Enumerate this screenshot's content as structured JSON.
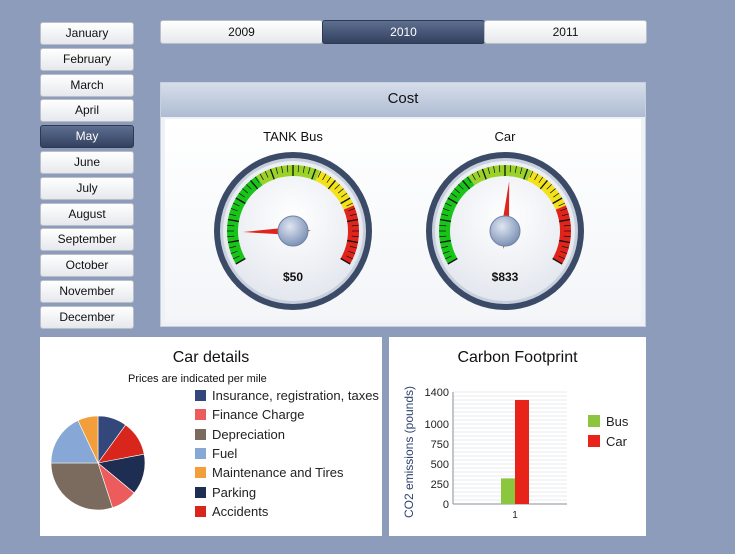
{
  "months": [
    "January",
    "February",
    "March",
    "April",
    "May",
    "June",
    "July",
    "August",
    "September",
    "October",
    "November",
    "December"
  ],
  "selected_month": "May",
  "years": [
    "2009",
    "2010",
    "2011"
  ],
  "selected_year": "2010",
  "cost": {
    "title": "Cost",
    "gauges": [
      {
        "name": "TANK Bus",
        "value_label": "$50",
        "needle_fraction": 0.12
      },
      {
        "name": "Car",
        "value_label": "$833",
        "needle_fraction": 0.52
      }
    ]
  },
  "car_details": {
    "title": "Car details",
    "subtitle": "Prices are indicated per mile",
    "legend": [
      {
        "label": "Insurance, registration, taxes",
        "color": "#34477a"
      },
      {
        "label": "Finance Charge",
        "color": "#ec5c5c"
      },
      {
        "label": "Depreciation",
        "color": "#7a6b5e"
      },
      {
        "label": "Fuel",
        "color": "#87a8d6"
      },
      {
        "label": "Maintenance and Tires",
        "color": "#f29e3b"
      },
      {
        "label": "Parking",
        "color": "#1e2d52"
      },
      {
        "label": "Accidents",
        "color": "#d8261c"
      }
    ],
    "chart_data": {
      "type": "pie",
      "slices": [
        {
          "label": "Insurance, registration, taxes",
          "value": 10,
          "color": "#34477a"
        },
        {
          "label": "Accidents",
          "value": 12,
          "color": "#d8261c"
        },
        {
          "label": "Parking",
          "value": 14,
          "color": "#1e2d52"
        },
        {
          "label": "Finance Charge",
          "value": 9,
          "color": "#ec5c5c"
        },
        {
          "label": "Depreciation",
          "value": 30,
          "color": "#7a6b5e"
        },
        {
          "label": "Fuel",
          "value": 18,
          "color": "#87a8d6"
        },
        {
          "label": "Maintenance and Tires",
          "value": 7,
          "color": "#f29e3b"
        }
      ]
    }
  },
  "carbon": {
    "title": "Carbon Footprint",
    "chart_data": {
      "type": "bar",
      "categories": [
        "1"
      ],
      "series": [
        {
          "name": "Bus",
          "values": [
            320
          ],
          "color": "#8cc63f"
        },
        {
          "name": "Car",
          "values": [
            1300
          ],
          "color": "#e8231a"
        }
      ],
      "ylabel": "CO2 emissions (pounds)",
      "yticks": [
        "0",
        "250",
        "500",
        "750",
        "1000",
        "1400"
      ],
      "ylim": [
        0,
        1400
      ],
      "grid": true,
      "legend": "right"
    }
  }
}
